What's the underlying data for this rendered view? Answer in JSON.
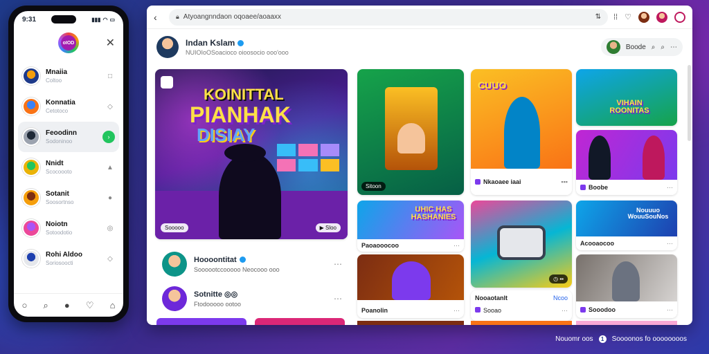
{
  "phone": {
    "time": "9:31",
    "status": [
      "▮▮▮",
      "◠",
      "▭"
    ],
    "logo_text": "oIOD",
    "chats": [
      {
        "name": "Mnaiia",
        "sub": "Coltoo",
        "action": "□",
        "colors": [
          "#f59e0b",
          "#1e3a8a"
        ]
      },
      {
        "name": "Konnatia",
        "sub": "Cetotoco",
        "action": "◇",
        "colors": [
          "#3b82f6",
          "#f97316"
        ]
      },
      {
        "name": "Feoodinn",
        "sub": "Sodoninoo",
        "action": "›",
        "colors": [
          "#1f2937",
          "#9ca3af"
        ]
      },
      {
        "name": "Nnidt",
        "sub": "Scocoooto",
        "action": "▲",
        "colors": [
          "#22c55e",
          "#eab308"
        ]
      },
      {
        "name": "Sotanit",
        "sub": "Soosortnso",
        "action": "●",
        "colors": [
          "#7c2d12",
          "#f59e0b"
        ]
      },
      {
        "name": "Noiotn",
        "sub": "Sotoodotio",
        "action": "◎",
        "colors": [
          "#a855f7",
          "#ec4899"
        ]
      },
      {
        "name": "Rohi Aldoo",
        "sub": "Soriosoocti",
        "action": "◇",
        "colors": [
          "#1e40af",
          "#e5e7eb"
        ]
      }
    ],
    "nav": [
      "○",
      "⌕",
      "●",
      "♡",
      "⌂"
    ]
  },
  "browser": {
    "url": "Atyoangnndaon oqoaee/aoaaxx",
    "toolbar": [
      "⇅",
      "⁞⁞",
      "♡"
    ],
    "profile": {
      "name": "Indan Kslam",
      "sub": "NUIOIoOSoacioco oioosocio ooo'ooo"
    },
    "search_label": "Boode"
  },
  "feed": {
    "hero": {
      "line1": "KOINITTAL",
      "line2": "PIANHAK",
      "line3": "DISIAY",
      "tag": "Sooooo",
      "tag_right": "Sloo"
    },
    "cards": {
      "c1": {
        "tag": "Sitoon"
      },
      "c2": {
        "img_text": "CUUO",
        "title": "Nkaoaee iaai",
        "right": "▪▪▪"
      },
      "c3": {
        "img_text": "VIHAIN ROONITAS"
      },
      "c4": {
        "title": "Boobe"
      },
      "c5": {
        "img_text": "UHIC HAS HASHANIES",
        "title": "Paoaooocoo"
      },
      "c6": {
        "title": "Nooaotanlt",
        "right": "Ncoo",
        "sub": "Sooao"
      },
      "c7": {
        "img_text": "Nouuuo WouuSouNos",
        "title": "Acooaocoo"
      },
      "c8": {
        "title": "Poanolin"
      },
      "c9": {
        "title": "Sooodoo"
      }
    },
    "posts": [
      {
        "name": "Hoooontitat",
        "sub": "Soooootccooooo Neocooo ooo",
        "dots": "⋯"
      },
      {
        "name": "Sotnitte ◎◎",
        "sub": "Ftodooooo ootoo",
        "dots": "⋯"
      }
    ]
  },
  "footer": {
    "left": "Nouomr oos",
    "badge": "1",
    "right": "Soooonos fo oooooooos"
  }
}
